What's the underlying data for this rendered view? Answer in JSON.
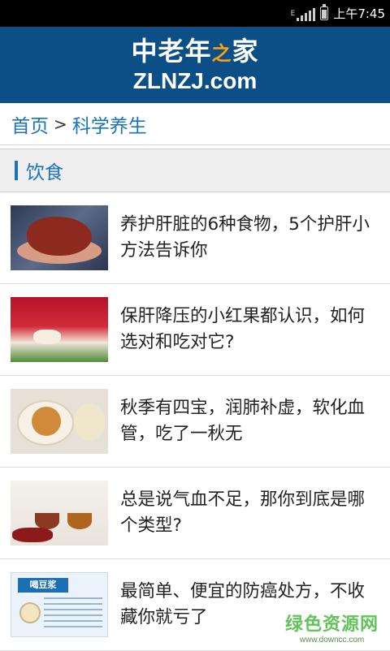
{
  "status_bar": {
    "network": "E",
    "time": "上午7:45"
  },
  "header": {
    "logo_cn_part1": "中老年",
    "logo_cn_accent": "之",
    "logo_cn_part2": "家",
    "logo_en": "ZLNZJ.com"
  },
  "breadcrumb": {
    "home": "首页",
    "separator": ">",
    "current": "科学养生"
  },
  "section": {
    "title": "饮食"
  },
  "articles": [
    {
      "title": "养护肝脏的6种食物，5个护肝小方法告诉你",
      "thumb_icon": "liver-hands-photo"
    },
    {
      "title": "保肝降压的小红果都认识，如何选对和吃对它?",
      "thumb_icon": "goji-berries-photo"
    },
    {
      "title": "秋季有四宝，润肺补虚，软化血管，吃了一秋无",
      "thumb_icon": "stewed-pear-photo"
    },
    {
      "title": "总是说气血不足，那你到底是哪个类型?",
      "thumb_icon": "tea-and-dates-photo"
    },
    {
      "title": "最简单、便宜的防癌处方，不收藏你就亏了",
      "thumb_icon": "soy-milk-infographic",
      "thumb_label": "喝豆浆"
    }
  ],
  "watermark": {
    "line1": "绿色资源网",
    "line2": "www.downcc.com"
  },
  "colors": {
    "header_bg": "#0b4f86",
    "link_blue": "#1a73c0",
    "section_bg": "#efefef",
    "logo_accent": "#f4a21b",
    "watermark_green": "#46b93e"
  }
}
